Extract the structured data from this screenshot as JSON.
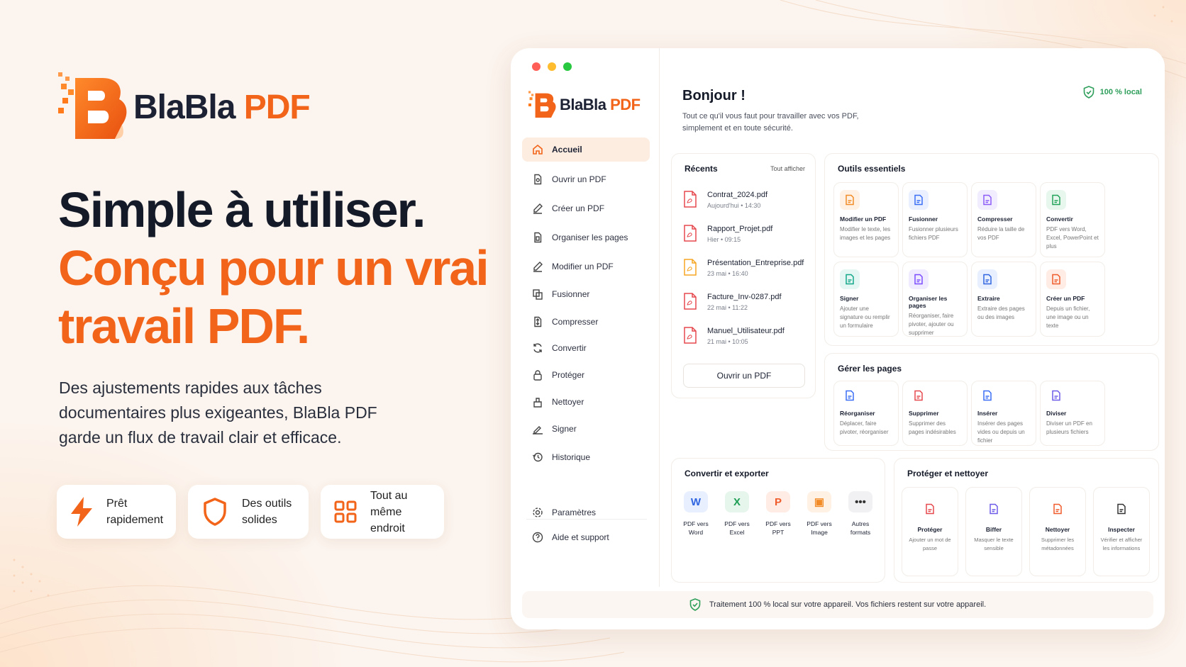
{
  "brand": {
    "name": "BlaBla",
    "suffix": "PDF"
  },
  "hero": {
    "line1": "Simple à utiliser.",
    "line2": "Conçu pour un vrai",
    "line3": "travail PDF.",
    "lead": "Des ajustements rapides aux tâches documentaires plus exigeantes, BlaBla PDF garde un flux de travail clair et efficace."
  },
  "features": [
    {
      "l1": "Prêt",
      "l2": "rapidement",
      "icon": "bolt-icon"
    },
    {
      "l1": "Des outils",
      "l2": "solides",
      "icon": "shield-icon"
    },
    {
      "l1": "Tout au même",
      "l2": "endroit",
      "icon": "grid-icon"
    }
  ],
  "sidebar": {
    "items": [
      "Accueil",
      "Ouvrir un PDF",
      "Créer un PDF",
      "Organiser les pages",
      "Modifier un PDF",
      "Fusionner",
      "Compresser",
      "Convertir",
      "Protéger",
      "Nettoyer",
      "Signer",
      "Historique"
    ],
    "bottom": [
      "Paramètres",
      "Aide et support"
    ]
  },
  "header": {
    "title": "Bonjour !",
    "subtitle_1": "Tout ce qu'il vous faut pour travailler avec vos PDF,",
    "subtitle_2": "simplement et en toute sécurité.",
    "badge": "100 % local"
  },
  "recents": {
    "title": "Récents",
    "link": "Tout afficher",
    "button": "Ouvrir un PDF",
    "files": [
      {
        "name": "Contrat_2024.pdf",
        "date": "Aujourd'hui • 14:30",
        "color": "#e5484d"
      },
      {
        "name": "Rapport_Projet.pdf",
        "date": "Hier • 09:15",
        "color": "#e5484d"
      },
      {
        "name": "Présentation_Entreprise.pdf",
        "date": "23 mai • 16:40",
        "color": "#f5a623"
      },
      {
        "name": "Facture_Inv-0287.pdf",
        "date": "22 mai • 11:22",
        "color": "#e5484d"
      },
      {
        "name": "Manuel_Utilisateur.pdf",
        "date": "21 mai • 10:05",
        "color": "#e5484d"
      }
    ]
  },
  "essentials": {
    "title": "Outils essentiels",
    "tools": [
      {
        "t": "Modifier un PDF",
        "d": "Modifier le texte, les images et les pages",
        "c": "#f28c28",
        "bg": "#fff1e3"
      },
      {
        "t": "Fusionner",
        "d": "Fusionner plusieurs fichiers PDF",
        "c": "#3b6ef5",
        "bg": "#eaf0ff"
      },
      {
        "t": "Compresser",
        "d": "Réduire la taille de vos PDF",
        "c": "#8b5cf6",
        "bg": "#f2ecff"
      },
      {
        "t": "Convertir",
        "d": "PDF vers Word, Excel, PowerPoint et plus",
        "c": "#22a35a",
        "bg": "#e8f7ee"
      },
      {
        "t": "Signer",
        "d": "Ajouter une signature ou remplir un formulaire",
        "c": "#14a88a",
        "bg": "#e5f7f2"
      },
      {
        "t": "Organiser les pages",
        "d": "Réorganiser, faire pivoter, ajouter ou supprimer",
        "c": "#7c4dff",
        "bg": "#f0ebff"
      },
      {
        "t": "Extraire",
        "d": "Extraire des pages ou des images",
        "c": "#2f66e0",
        "bg": "#e8efff"
      },
      {
        "t": "Créer un PDF",
        "d": "Depuis un fichier, une image ou un texte",
        "c": "#ef5b2a",
        "bg": "#ffece4"
      }
    ]
  },
  "pages": {
    "title": "Gérer les pages",
    "tools": [
      {
        "t": "Réorganiser",
        "d": "Déplacer, faire pivoter, réorganiser",
        "c": "#3b6ef5"
      },
      {
        "t": "Supprimer",
        "d": "Supprimer des pages indésirables",
        "c": "#e5484d"
      },
      {
        "t": "Insérer",
        "d": "Insérer des pages vides ou depuis un fichier",
        "c": "#3b6ef5"
      },
      {
        "t": "Diviser",
        "d": "Diviser un PDF en plusieurs fichiers",
        "c": "#6d5ce8"
      }
    ]
  },
  "convert": {
    "title": "Convertir et exporter",
    "tools": [
      {
        "t": "PDF vers Word",
        "c": "#2f66e0",
        "bg": "#e8efff",
        "g": "W"
      },
      {
        "t": "PDF vers Excel",
        "c": "#1e9e55",
        "bg": "#e6f6ec",
        "g": "X"
      },
      {
        "t": "PDF vers PPT",
        "c": "#ef5b2a",
        "bg": "#ffece4",
        "g": "P"
      },
      {
        "t": "PDF vers Image",
        "c": "#f28c28",
        "bg": "#fff1e3",
        "g": "▣"
      },
      {
        "t": "Autres formats",
        "c": "#333",
        "bg": "#f1f1f3",
        "g": "•••"
      }
    ]
  },
  "protect": {
    "title": "Protéger et nettoyer",
    "tools": [
      {
        "t": "Protéger",
        "d": "Ajouter un mot de passe",
        "c": "#e5484d"
      },
      {
        "t": "Biffer",
        "d": "Masquer le texte sensible",
        "c": "#6d5ce8"
      },
      {
        "t": "Nettoyer",
        "d": "Supprimer les métadonnées",
        "c": "#ef5b2a"
      },
      {
        "t": "Inspecter",
        "d": "Vérifier et afficher les informations",
        "c": "#333"
      }
    ]
  },
  "footer": "Traitement 100 % local sur votre appareil. Vos fichiers restent sur votre appareil."
}
